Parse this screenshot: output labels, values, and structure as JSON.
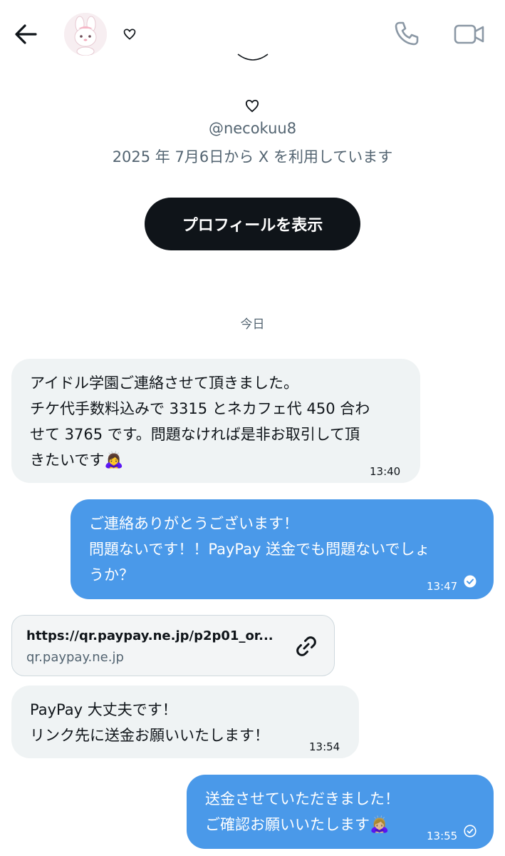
{
  "header": {
    "back_icon": "arrow-left-icon",
    "avatar_icon": "bunny-avatar",
    "heart_icon": "heart-outline-icon",
    "phone_icon": "phone-icon",
    "video_icon": "video-camera-icon"
  },
  "profile": {
    "heart_icon": "heart-outline-icon",
    "handle": "@necokuu8",
    "joined": "2025 年 7月6日から X を利用しています",
    "view_profile_label": "プロフィールを表示"
  },
  "date_separator": "今日",
  "messages": [
    {
      "direction": "incoming",
      "lines": [
        "アイドル学園ご連絡させて頂きました。",
        "チケ代手数料込みで 3315 とネカフェ代 450 合わ",
        "せて 3765 です。問題なければ是非お取引して頂",
        "きたいです"
      ],
      "emoji": "🙇‍♀️",
      "time": "13:40"
    },
    {
      "direction": "outgoing",
      "lines": [
        "ご連絡ありがとうございます！",
        "問題ないです！！PayPay 送金でも問題ないでしょ",
        "うか？"
      ],
      "time": "13:47",
      "status_icon": "read-check-icon"
    },
    {
      "direction": "incoming",
      "type": "link",
      "url": "https://qr.paypay.ne.jp/p2p01_or...",
      "domain": "qr.paypay.ne.jp",
      "icon": "link-icon"
    },
    {
      "direction": "incoming",
      "lines": [
        "PayPay 大丈夫です！",
        "リンク先に送金お願いいたします！"
      ],
      "time": "13:54"
    },
    {
      "direction": "outgoing",
      "lines": [
        "送金させていただきました！",
        "ご確認お願いいたします"
      ],
      "emoji": "🙇🏼‍♀️",
      "time": "13:55",
      "status_icon": "sent-check-icon"
    }
  ]
}
